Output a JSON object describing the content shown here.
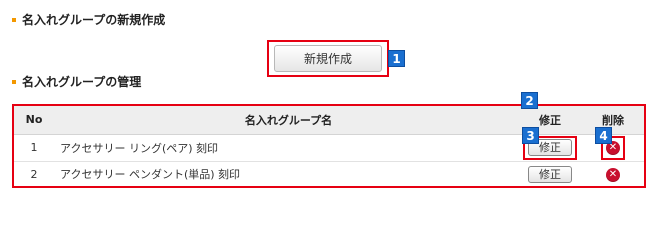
{
  "sections": {
    "create_title": "名入れグループの新規作成",
    "manage_title": "名入れグループの管理"
  },
  "create_button": "新規作成",
  "markers": [
    "1",
    "2",
    "3",
    "4"
  ],
  "table": {
    "headers": {
      "no": "No",
      "name": "名入れグループ名",
      "edit": "修正",
      "delete": "削除"
    },
    "rows": [
      {
        "no": "1",
        "name": "アクセサリー リング(ペア) 刻印",
        "edit_label": "修正"
      },
      {
        "no": "2",
        "name": "アクセサリー ペンダント(単品) 刻印",
        "edit_label": "修正"
      }
    ]
  },
  "icons": {
    "delete": "close-circle-icon",
    "bullet": "square-bullet-icon"
  },
  "colors": {
    "highlight": "#e60012",
    "marker": "#1a6fd0",
    "bullet": "#f39800",
    "delete": "#c8102e"
  }
}
